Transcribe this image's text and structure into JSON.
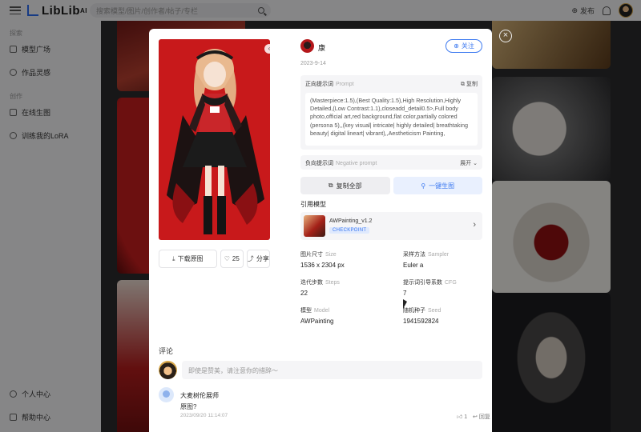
{
  "app": {
    "logo_text": "LibLib",
    "logo_suffix": "AI",
    "search_placeholder": "搜索模型/图片/创作者/帖子/专栏",
    "publish_label": "发布"
  },
  "sidebar": {
    "groups": [
      {
        "label": "探索",
        "items": [
          "模型广场",
          "作品灵感"
        ]
      },
      {
        "label": "创作",
        "items": [
          "在线生图",
          "训练我的LoRA"
        ]
      }
    ],
    "bottom_items": [
      "个人中心",
      "帮助中心"
    ]
  },
  "modal": {
    "close_symbol": "×",
    "author": {
      "name": "康",
      "date": "2023-9-14"
    },
    "follow_label": "关注",
    "prompt": {
      "label": "正向提示词",
      "label_en": "Prompt",
      "copy_label": "复制",
      "text": "(Masterpiece:1.5),(Best Quality:1.5),High Resolution,Highly Detailed,(Low Contrast:1.1),closeadd_detail0.5>,Full body photo,official art,red background,flat color,partially colored (persona 5),,(key visual| intricate| highly detailed| breathtaking beauty| digital lineart| vibrant),,Aestheticism Painting,"
    },
    "negative": {
      "label": "负向提示词",
      "label_en": "Negative prompt",
      "expand_label": "展开"
    },
    "copy_all_label": "复制全部",
    "generate_label": "一键生图",
    "model_section_title": "引用模型",
    "model": {
      "name": "AWPainting_v1.2",
      "tag": "CHECKPOINT"
    },
    "artwork_nav": {
      "prev": "‹",
      "next": "›"
    },
    "actions": {
      "download_label": "下载原图",
      "like_count": "25",
      "share_label": "分享"
    },
    "params": [
      {
        "label": "图片尺寸",
        "label_en": "Size",
        "value": "1536 x 2304 px"
      },
      {
        "label": "采样方法",
        "label_en": "Sampler",
        "value": "Euler a"
      },
      {
        "label": "迭代步数",
        "label_en": "Steps",
        "value": "22"
      },
      {
        "label": "提示词引导系数",
        "label_en": "CFG",
        "value": "7"
      },
      {
        "label": "模型",
        "label_en": "Model",
        "value": "AWPainting"
      },
      {
        "label": "随机种子",
        "label_en": "Seed",
        "value": "1941592824"
      }
    ],
    "comments": {
      "title": "评论",
      "input_placeholder": "即使是赞美，请注意你的措辞～",
      "items": [
        {
          "user": "大麦树伦展师",
          "text": "原图?",
          "time": "2023/09/20 11:14:07",
          "likes": "1",
          "reply_label": "回复"
        }
      ]
    }
  },
  "colors": {
    "accent": "#3c79f0",
    "artwork_bg": "#c8191b"
  }
}
